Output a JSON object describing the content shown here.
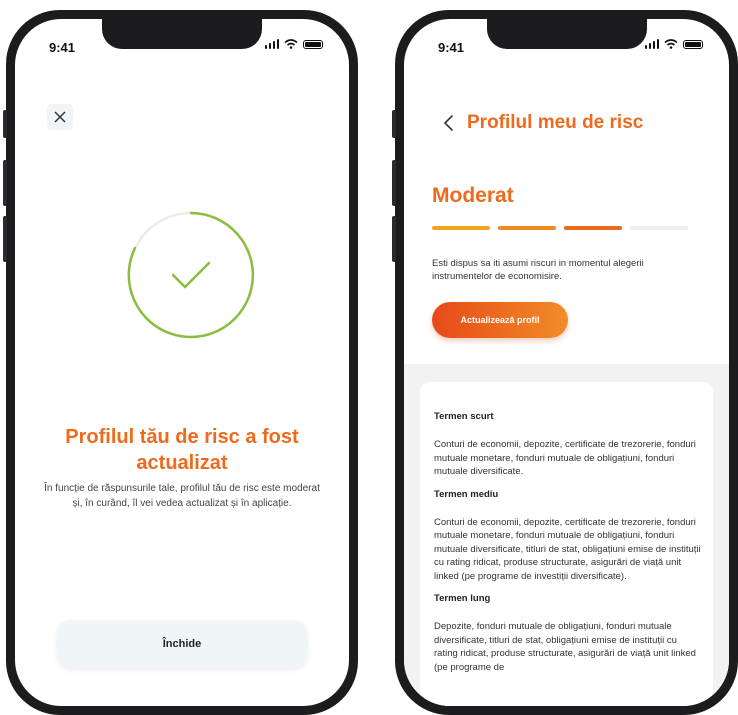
{
  "status_bar": {
    "time": "9:41"
  },
  "left_screen": {
    "close_icon": "close-icon",
    "success_icon": "checkmark-icon",
    "title": "Profilul tău de risc a fost actualizat",
    "description": "În funcție de răspunsurile tale, profilul tău de risc este moderat și, în curând, îl vei vedea actualizat și în aplicație.",
    "close_button": "Închide",
    "accent_color": "#ee6a1c",
    "ring_color": "#8bbd3f"
  },
  "right_screen": {
    "back_icon": "chevron-left-icon",
    "title": "Profilul meu de risc",
    "risk_level": "Moderat",
    "risk_scale": {
      "filled_segments": 3,
      "total_segments": 4
    },
    "description": "Esti dispus sa iti asumi riscuri in momentul alegerii instrumentelor de economisire.",
    "update_button": "Actualizează profil",
    "terms": [
      {
        "heading": "Termen scurt",
        "body": "Conturi de economii, depozite, certificate de trezorerie, fonduri mutuale monetare, fonduri mutuale de obligațiuni, fonduri mutuale diversificate."
      },
      {
        "heading": "Termen mediu",
        "body": "Conturi de economii, depozite, certificate de trezorerie, fonduri mutuale monetare, fonduri mutuale de obligațiuni, fonduri mutuale diversificate, titluri de stat, obligațiuni emise de instituții cu rating ridicat, produse structurate, asigurări de viață unit linked (pe programe de investiții diversificate)."
      },
      {
        "heading": "Termen lung",
        "body": "Depozite, fonduri mutuale de obligațiuni, fonduri mutuale diversificate, titluri de stat, obligațiuni emise de instituții cu rating ridicat, produse structurate, asigurări de viață unit linked (pe programe de"
      }
    ]
  }
}
